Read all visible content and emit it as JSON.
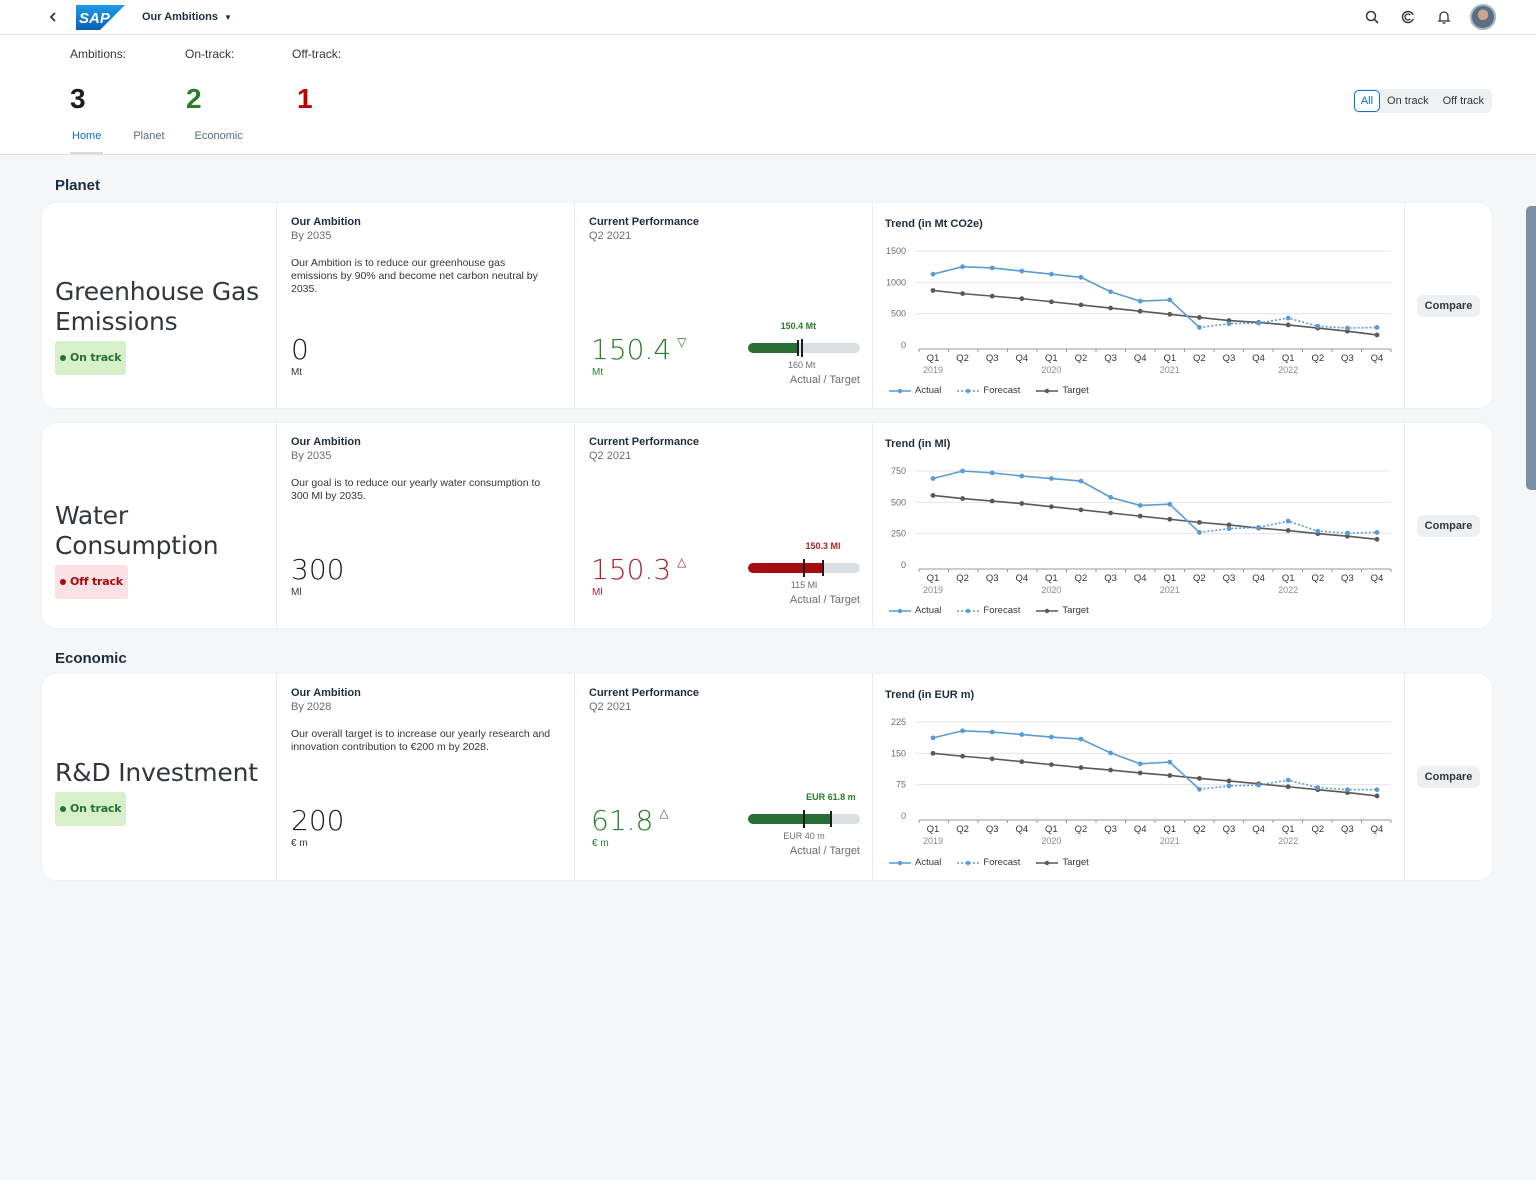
{
  "shell": {
    "app_title": "Our Ambitions",
    "logo_text": "SAP",
    "icons": [
      "back-icon",
      "search-icon",
      "joule-icon",
      "bell-icon",
      "avatar"
    ]
  },
  "header": {
    "kpis": [
      {
        "label": "Ambitions:",
        "value": "3"
      },
      {
        "label": "On-track:",
        "value": "2"
      },
      {
        "label": "Off-track:",
        "value": "1"
      }
    ],
    "tabs": [
      {
        "label": "Home",
        "active": true
      },
      {
        "label": "Planet",
        "active": false
      },
      {
        "label": "Economic",
        "active": false
      }
    ],
    "filter": {
      "options": [
        "All",
        "On track",
        "Off track"
      ],
      "selected": "All"
    }
  },
  "sections": [
    {
      "title": "Planet"
    },
    {
      "title": "Economic"
    }
  ],
  "colors": {
    "on_track": "#2b7c2b",
    "off_track": "#a9252c",
    "actual_line": "#5b9bd5",
    "target_line": "#595959",
    "accent": "#0a6ed1"
  },
  "cards": [
    {
      "name": "Greenhouse Gas Emissions",
      "name_lines": [
        "Greenhouse Gas",
        "Emissions"
      ],
      "status": "On track",
      "status_type": "on",
      "ambition_title": "Our Ambition",
      "ambition_by": "By 2035",
      "ambition_desc": "Our Ambition is to reduce our greenhouse gas emissions by 90% and become net carbon neutral by 2035.",
      "ambition_value": "0",
      "ambition_unit": "Mt",
      "perf_title": "Current Performance",
      "perf_period": "Q2 2021",
      "perf_value": "150.4",
      "perf_arrow": "▽",
      "perf_unit": "Mt",
      "bullet_actual_label": "150.4 Mt",
      "bullet_target_label": "160 Mt",
      "bullet_actual_fraction": 0.45,
      "bullet_target_fraction": 0.48,
      "bullet_caption": "Actual / Target",
      "compare_label": "Compare"
    },
    {
      "name": "Water Consumption",
      "name_lines": [
        "Water",
        "Consumption"
      ],
      "status": "Off track",
      "status_type": "off",
      "ambition_title": "Our Ambition",
      "ambition_by": "By 2035",
      "ambition_desc": "Our goal is to reduce our yearly water consumption to 300 Ml by 2035.",
      "ambition_value": "300",
      "ambition_unit": "Ml",
      "perf_title": "Current Performance",
      "perf_period": "Q2 2021",
      "perf_value": "150.3",
      "perf_arrow": "△",
      "perf_unit": "Ml",
      "bullet_actual_label": "150.3 Ml",
      "bullet_target_label": "115 Ml",
      "bullet_actual_fraction": 0.67,
      "bullet_target_fraction": 0.5,
      "bullet_caption": "Actual / Target",
      "compare_label": "Compare"
    },
    {
      "name": "R&D Investment",
      "name_lines": [
        "R&D Investment"
      ],
      "status": "On track",
      "status_type": "on",
      "ambition_title": "Our Ambition",
      "ambition_by": "By 2028",
      "ambition_desc": "Our overall target is to increase our yearly research and innovation contribution to €200 m by 2028.",
      "ambition_value": "200",
      "ambition_unit": "€ m",
      "perf_title": "Current Performance",
      "perf_period": "Q2 2021",
      "perf_value": "61.8",
      "perf_arrow": "△",
      "perf_unit": "€ m",
      "bullet_actual_label": "EUR 61.8 m",
      "bullet_target_label": "EUR 40 m",
      "bullet_actual_fraction": 0.74,
      "bullet_target_fraction": 0.5,
      "bullet_caption": "Actual / Target",
      "compare_label": "Compare"
    }
  ],
  "chart_data": [
    {
      "type": "line",
      "title": "Trend (in Mt CO2e)",
      "categories": [
        "Q1",
        "Q2",
        "Q3",
        "Q4",
        "Q1",
        "Q2",
        "Q3",
        "Q4",
        "Q1",
        "Q2",
        "Q3",
        "Q4",
        "Q1",
        "Q2",
        "Q3",
        "Q4"
      ],
      "year_labels": {
        "0": "2019",
        "4": "2020",
        "8": "2021",
        "12": "2022"
      },
      "yticks": [
        0,
        500,
        1000,
        1500
      ],
      "ylim": [
        0,
        1500
      ],
      "grid": true,
      "legend": "bottom-left",
      "series": [
        {
          "name": "Actual",
          "style": "solid",
          "color": "#5b9bd5",
          "start": 0,
          "values": [
            1130,
            1250,
            1230,
            1180,
            1130,
            1080,
            850,
            700,
            720,
            280
          ]
        },
        {
          "name": "Forecast",
          "style": "dotted",
          "color": "#5b9bd5",
          "start": 9,
          "values": [
            280,
            340,
            350,
            430,
            300,
            270,
            280
          ]
        },
        {
          "name": "Target",
          "style": "solid",
          "color": "#595959",
          "start": 0,
          "values": [
            870,
            820,
            780,
            740,
            690,
            640,
            590,
            540,
            490,
            440,
            390,
            360,
            320,
            270,
            220,
            160
          ]
        }
      ]
    },
    {
      "type": "line",
      "title": "Trend (in Ml)",
      "categories": [
        "Q1",
        "Q2",
        "Q3",
        "Q4",
        "Q1",
        "Q2",
        "Q3",
        "Q4",
        "Q1",
        "Q2",
        "Q3",
        "Q4",
        "Q1",
        "Q2",
        "Q3",
        "Q4"
      ],
      "year_labels": {
        "0": "2019",
        "4": "2020",
        "8": "2021",
        "12": "2022"
      },
      "yticks": [
        0,
        250,
        500,
        750
      ],
      "ylim": [
        0,
        750
      ],
      "grid": true,
      "legend": "bottom-left",
      "series": [
        {
          "name": "Actual",
          "style": "solid",
          "color": "#5b9bd5",
          "start": 0,
          "values": [
            690,
            750,
            735,
            710,
            690,
            670,
            540,
            475,
            485,
            260
          ]
        },
        {
          "name": "Forecast",
          "style": "dotted",
          "color": "#5b9bd5",
          "start": 9,
          "values": [
            260,
            290,
            300,
            350,
            270,
            255,
            260
          ]
        },
        {
          "name": "Target",
          "style": "solid",
          "color": "#595959",
          "start": 0,
          "values": [
            555,
            530,
            510,
            490,
            465,
            440,
            415,
            390,
            365,
            340,
            320,
            295,
            275,
            250,
            230,
            205
          ]
        }
      ]
    },
    {
      "type": "line",
      "title": "Trend (in EUR m)",
      "categories": [
        "Q1",
        "Q2",
        "Q3",
        "Q4",
        "Q1",
        "Q2",
        "Q3",
        "Q4",
        "Q1",
        "Q2",
        "Q3",
        "Q4",
        "Q1",
        "Q2",
        "Q3",
        "Q4"
      ],
      "year_labels": {
        "0": "2019",
        "4": "2020",
        "8": "2021",
        "12": "2022"
      },
      "yticks": [
        0,
        75,
        150,
        225
      ],
      "ylim": [
        0,
        225
      ],
      "grid": true,
      "legend": "bottom-left",
      "series": [
        {
          "name": "Actual",
          "style": "solid",
          "color": "#5b9bd5",
          "start": 0,
          "values": [
            187,
            204,
            201,
            195,
            189,
            184,
            151,
            125,
            129,
            64
          ]
        },
        {
          "name": "Forecast",
          "style": "dotted",
          "color": "#5b9bd5",
          "start": 9,
          "values": [
            64,
            72,
            74,
            86,
            68,
            63,
            63
          ]
        },
        {
          "name": "Target",
          "style": "solid",
          "color": "#595959",
          "start": 0,
          "values": [
            150,
            143,
            137,
            130,
            123,
            116,
            110,
            103,
            97,
            90,
            84,
            77,
            70,
            63,
            56,
            48
          ]
        }
      ]
    }
  ]
}
